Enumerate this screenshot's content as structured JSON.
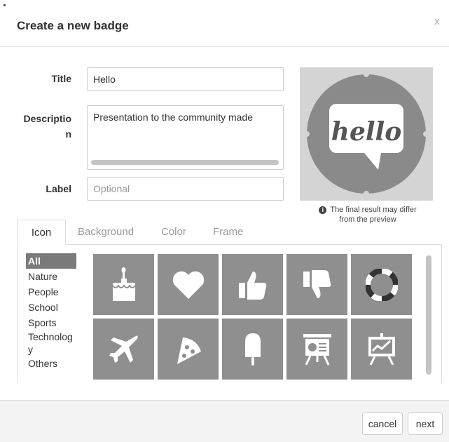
{
  "dialog": {
    "title": "Create a new badge",
    "close_label": "x"
  },
  "form": {
    "title_label": "Title",
    "title_value": "Hello",
    "description_label_line1": "Descriptio",
    "description_label_line2": "n",
    "description_value": "Presentation to the community made",
    "label_label": "Label",
    "label_placeholder": "Optional"
  },
  "preview": {
    "image_text": "hello",
    "note_line1": "The final result may differ",
    "note_line2": "from the preview"
  },
  "tabs": [
    {
      "label": "Icon",
      "active": true
    },
    {
      "label": "Background",
      "active": false
    },
    {
      "label": "Color",
      "active": false
    },
    {
      "label": "Frame",
      "active": false
    }
  ],
  "categories": [
    {
      "label": "All",
      "active": true
    },
    {
      "label": "Nature"
    },
    {
      "label": "People"
    },
    {
      "label": "School"
    },
    {
      "label": "Sports"
    },
    {
      "label": "Technolog"
    },
    {
      "label": "y"
    },
    {
      "label": "Others"
    }
  ],
  "icons": [
    "birthday-cake-icon",
    "heart-icon",
    "thumbs-up-icon",
    "thumbs-down-icon",
    "lifebuoy-icon",
    "airplane-icon",
    "pizza-icon",
    "popsicle-icon",
    "presentation-board-icon",
    "growth-chart-board-icon"
  ],
  "footer": {
    "cancel_label": "cancel",
    "next_label": "next"
  }
}
